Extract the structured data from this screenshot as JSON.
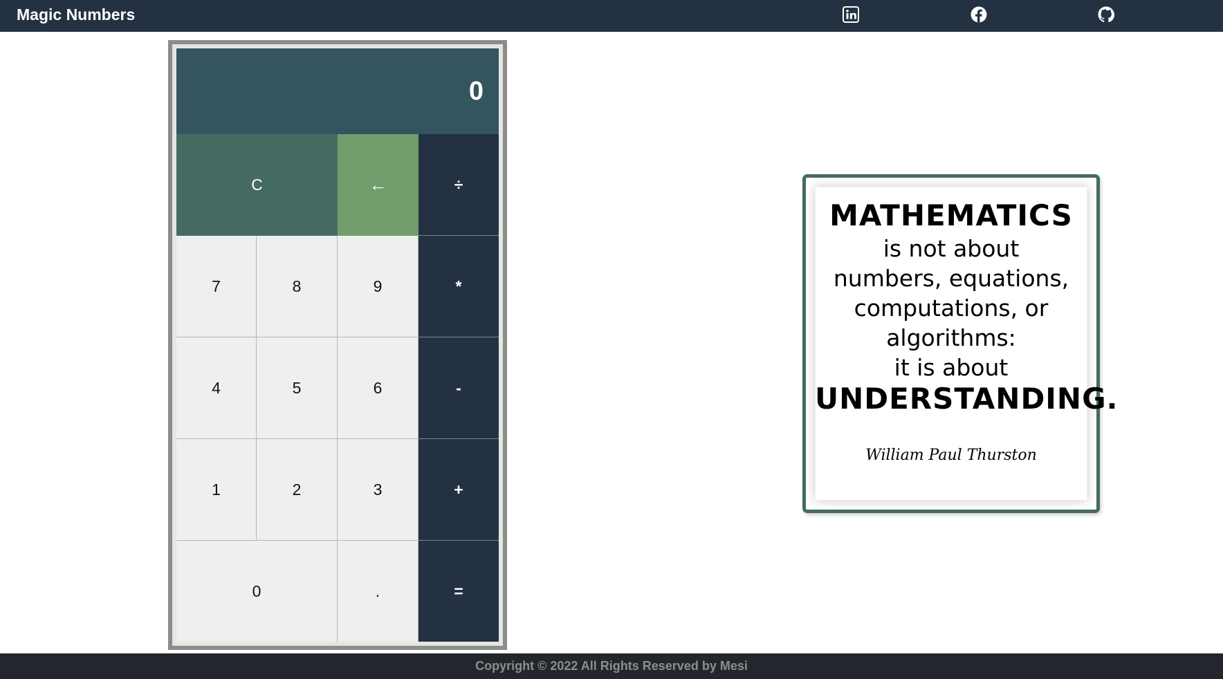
{
  "header": {
    "brand": "Magic Numbers",
    "background": "#243142",
    "social": [
      {
        "name": "linkedin",
        "icon": "linkedin-icon"
      },
      {
        "name": "facebook",
        "icon": "facebook-icon"
      },
      {
        "name": "github",
        "icon": "github-icon"
      }
    ]
  },
  "calculator": {
    "display": "0",
    "keys": {
      "clear": "C",
      "backspace": "←",
      "divide": "÷",
      "multiply": "*",
      "subtract": "-",
      "add": "+",
      "equals": "=",
      "decimal": ".",
      "seven": "7",
      "eight": "8",
      "nine": "9",
      "four": "4",
      "five": "5",
      "six": "6",
      "one": "1",
      "two": "2",
      "three": "3",
      "zero": "0"
    },
    "colors": {
      "display": "#34555f",
      "clear": "#456b62",
      "backspace": "#719e6c",
      "operator": "#243142",
      "number": "#efefef"
    }
  },
  "quote": {
    "line1": "MATHEMATICS",
    "line2": "is not about",
    "line3": "numbers, equations,",
    "line4": "computations, or",
    "line5": "algorithms:",
    "line6": "it is about",
    "line7": "UNDERSTANDING.",
    "author": "William Paul Thurston"
  },
  "footer": {
    "copyright": "Copyright © 2022 All Rights Reserved by Mesi"
  }
}
